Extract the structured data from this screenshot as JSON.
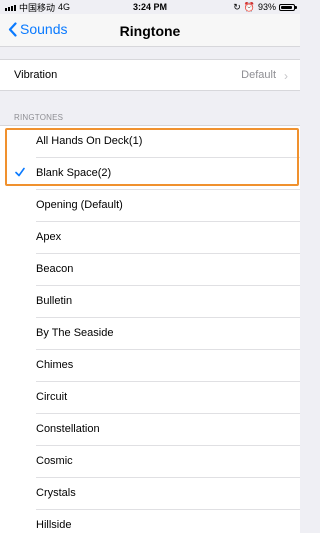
{
  "status_bar": {
    "carrier": "中国移动",
    "network": "4G",
    "time": "3:24 PM",
    "battery": "93%"
  },
  "nav": {
    "back_label": "Sounds",
    "title": "Ringtone"
  },
  "vibration": {
    "label": "Vibration",
    "value": "Default"
  },
  "section_header": "RINGTONES",
  "ringtones": [
    {
      "name": "All Hands On Deck(1)",
      "selected": false
    },
    {
      "name": "Blank Space(2)",
      "selected": true
    },
    {
      "name": "Opening (Default)",
      "selected": false
    },
    {
      "name": "Apex",
      "selected": false
    },
    {
      "name": "Beacon",
      "selected": false
    },
    {
      "name": "Bulletin",
      "selected": false
    },
    {
      "name": "By The Seaside",
      "selected": false
    },
    {
      "name": "Chimes",
      "selected": false
    },
    {
      "name": "Circuit",
      "selected": false
    },
    {
      "name": "Constellation",
      "selected": false
    },
    {
      "name": "Cosmic",
      "selected": false
    },
    {
      "name": "Crystals",
      "selected": false
    },
    {
      "name": "Hillside",
      "selected": false
    }
  ],
  "colors": {
    "accent": "#0a7aff",
    "highlight": "#f0912e",
    "secondary_text": "#8e8e93"
  },
  "icons": {
    "back": "chevron-left-icon",
    "selected": "checkmark-icon",
    "disclosure": "chevron-right-icon"
  }
}
